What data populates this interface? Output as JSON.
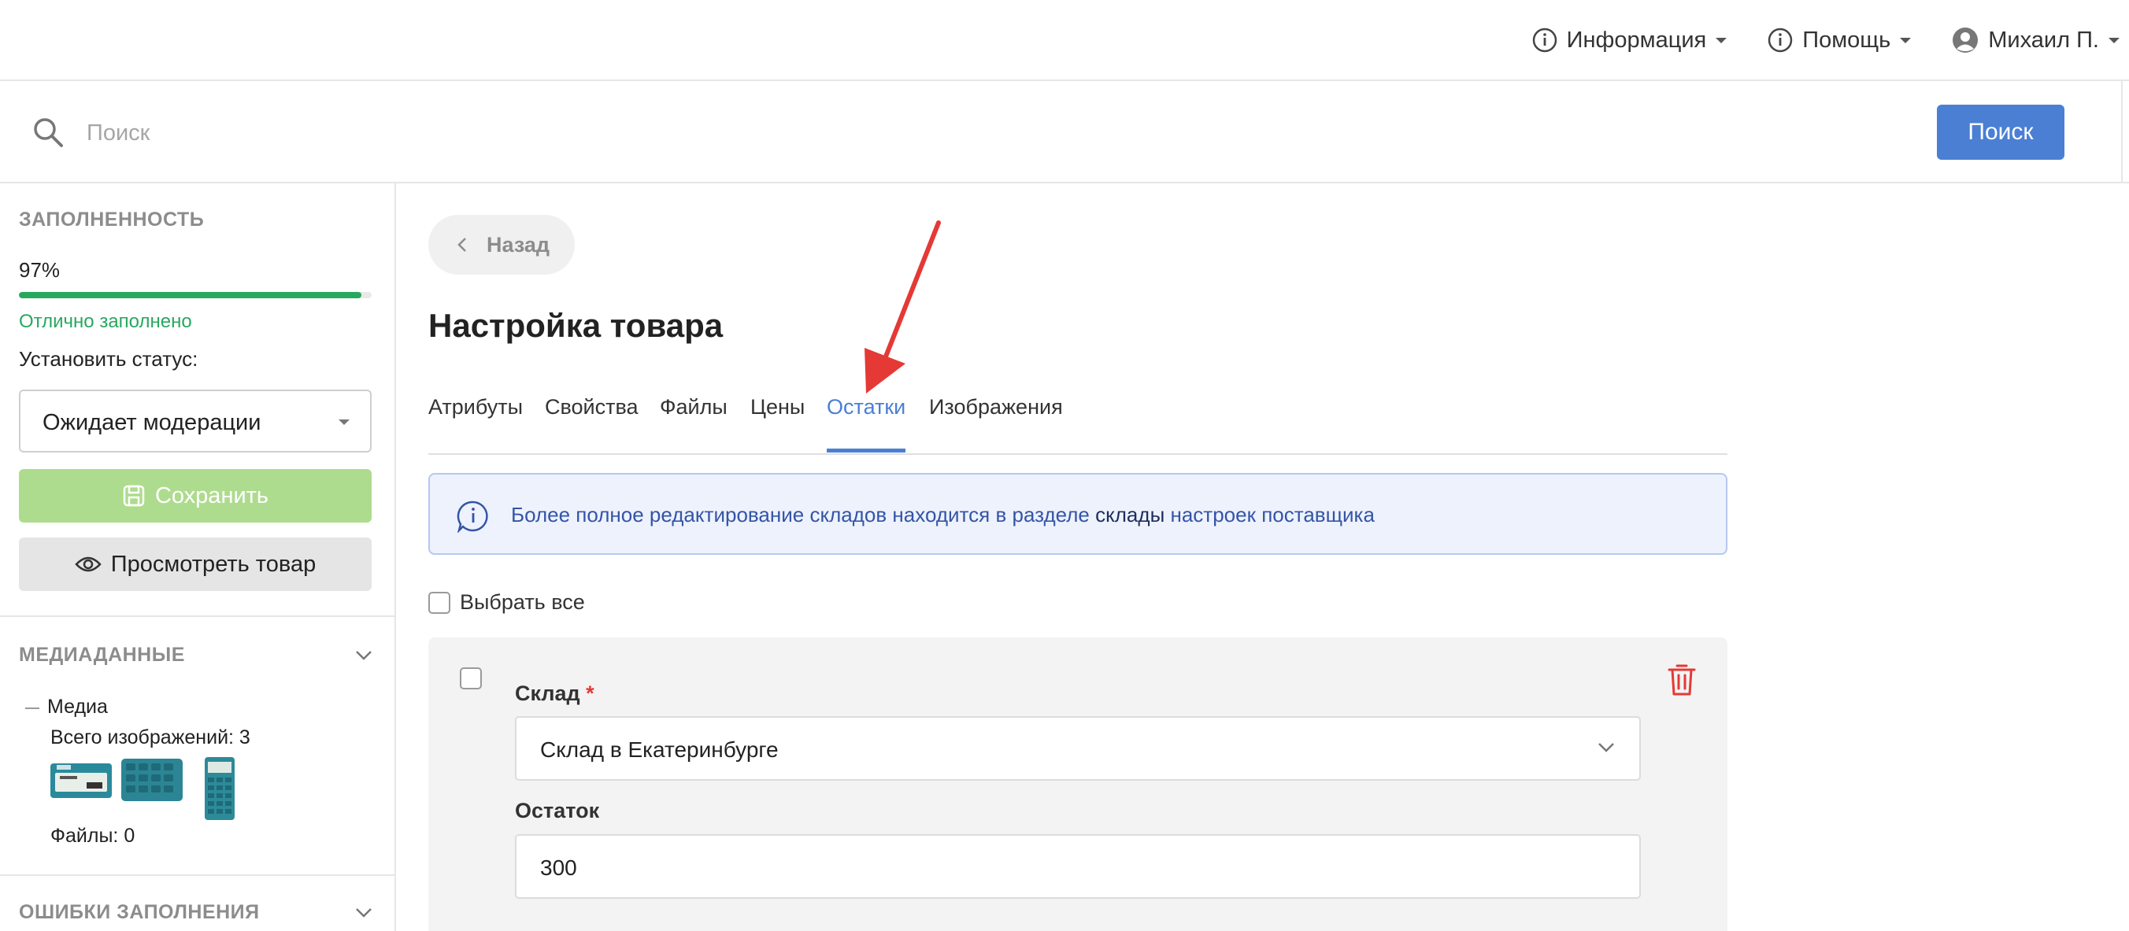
{
  "header": {
    "nav": [
      {
        "label": "Информация",
        "icon": "info-icon"
      },
      {
        "label": "Помощь",
        "icon": "info-icon"
      },
      {
        "label": "Михаил П.",
        "icon": "user-icon"
      }
    ]
  },
  "search": {
    "placeholder": "Поиск",
    "button_label": "Поиск"
  },
  "sidebar": {
    "fill_section_title": "ЗАПОЛНЕННОСТЬ",
    "fill_percent_text": "97%",
    "fill_percent": 97,
    "fill_status": "Отлично заполнено",
    "status_label": "Установить статус:",
    "status_value": "Ожидает модерации",
    "save_label": "Сохранить",
    "view_label": "Просмотреть товар",
    "media_section_title": "МЕДИАДАННЫЕ",
    "media_label": "Медиа",
    "images_count": "Всего изображений: 3",
    "files_count": "Файлы: 0",
    "errors_section_title": "ОШИБКИ ЗАПОЛНЕНИЯ"
  },
  "main": {
    "back_label": "Назад",
    "title": "Настройка товара",
    "tabs": [
      {
        "label": "Атрибуты"
      },
      {
        "label": "Свойства"
      },
      {
        "label": "Файлы"
      },
      {
        "label": "Цены"
      },
      {
        "label": "Остатки",
        "active": true
      },
      {
        "label": "Изображения"
      }
    ],
    "info": {
      "text_before": "Более полное редактирование складов находится в разделе",
      "link": "склады",
      "text_after": "настроек поставщика"
    },
    "select_all_label": "Выбрать все",
    "stock_card": {
      "warehouse_label": "Склад",
      "required_mark": "*",
      "warehouse_value": "Склад в Екатеринбурге",
      "stock_label": "Остаток",
      "stock_value": "300"
    }
  },
  "colors": {
    "accent": "#4a7fd4",
    "success": "#27a85f",
    "save_disabled": "#aedc8e",
    "danger": "#e53935",
    "annotation_arrow": "#e53935"
  }
}
